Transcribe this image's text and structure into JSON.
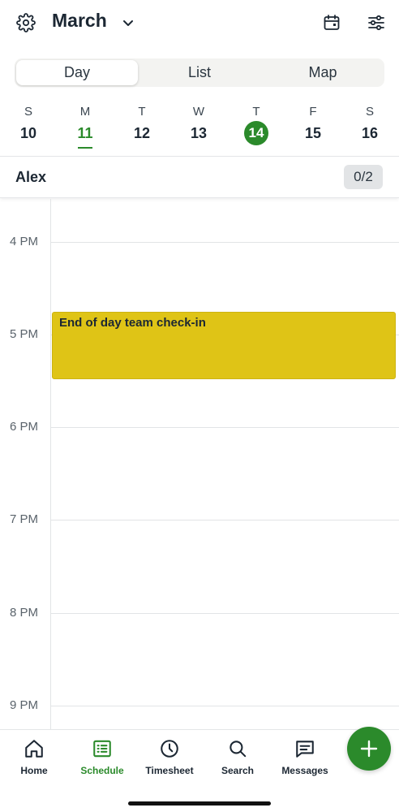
{
  "header": {
    "month": "March",
    "icons": [
      "gear-icon",
      "chevron-down-icon",
      "calendar-icon",
      "filter-icon"
    ]
  },
  "view_tabs": [
    {
      "label": "Day",
      "active": true
    },
    {
      "label": "List",
      "active": false
    },
    {
      "label": "Map",
      "active": false
    }
  ],
  "week": [
    {
      "dow": "S",
      "num": "10"
    },
    {
      "dow": "M",
      "num": "11",
      "current": true
    },
    {
      "dow": "T",
      "num": "12"
    },
    {
      "dow": "W",
      "num": "13"
    },
    {
      "dow": "T",
      "num": "14",
      "selected": true
    },
    {
      "dow": "F",
      "num": "15"
    },
    {
      "dow": "S",
      "num": "16"
    }
  ],
  "user": {
    "name": "Alex",
    "count": "0/2"
  },
  "hours": [
    "4 PM",
    "5 PM",
    "6 PM",
    "7 PM",
    "8 PM",
    "9 PM"
  ],
  "event": {
    "title": "End of day team check-in",
    "color": "#dfc416"
  },
  "nav": [
    {
      "label": "Home",
      "icon": "home-icon"
    },
    {
      "label": "Schedule",
      "icon": "schedule-icon",
      "active": true
    },
    {
      "label": "Timesheet",
      "icon": "clock-icon"
    },
    {
      "label": "Search",
      "icon": "search-icon"
    },
    {
      "label": "Messages",
      "icon": "messages-icon"
    }
  ],
  "colors": {
    "accent": "#2b8a2b",
    "text": "#1c2733"
  }
}
